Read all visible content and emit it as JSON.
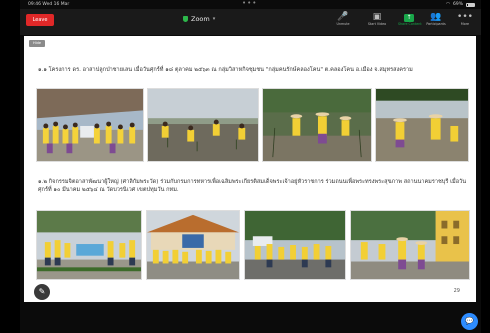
{
  "status_bar": {
    "time": "09:46  Wed 16 Mar",
    "dots": "•••",
    "battery": "69%"
  },
  "toolbar": {
    "leave_label": "Leave",
    "meeting_title": "Zoom",
    "items": [
      {
        "icon": "mic-muted-icon",
        "glyph": "🎤",
        "label": "Unmute"
      },
      {
        "icon": "video-off-icon",
        "glyph": "▣",
        "label": "Start Video"
      },
      {
        "icon": "share-content-icon",
        "glyph": "↑",
        "label": "Share Content"
      },
      {
        "icon": "participants-icon",
        "glyph": "👥",
        "label": "Participants"
      },
      {
        "icon": "more-icon",
        "glyph": "•••",
        "label": "More"
      }
    ]
  },
  "slide": {
    "view_tag": "Hide",
    "caption_1": "๑.๑ โครงการ ดร. อาสาปลูกป่าชายเลน เมื่อวันศุกร์ที่ ๑๘ ตุลาคม ๒๕๖๓ ณ กลุ่มวิสาหกิจชุมชน \"กลุ่มคนรักษ์คลองโคน\" ต.คลองโคน อ.เมือง จ.สมุทรสงคราม",
    "caption_2": "๑.๒ กิจกรรมจิตอาสาพัฒนาผู้ใหญ่ (ศาลิกัมพระวัด) ร่วมกับกรมการทหารเพื่อเฉลิมพระเกียรติสมเด็จพระเจ้าอยู่หัวราชการ ร่วมถนนเพื่อพระทรงพระสุขภาพ สถานนาคมราชบุรี เมื่อวันศุกร์ที่ ๑๐ มีนาคม ๒๕๖๔ ณ วัดบวรนิเวศ เขตปทุมวัน กทม.",
    "page_number": "29",
    "pen_icon": "✎",
    "row1_photos": [
      {
        "name": "photo-group-gathering",
        "scene": "group"
      },
      {
        "name": "photo-mangrove-planting-1",
        "scene": "mud"
      },
      {
        "name": "photo-mangrove-planting-2",
        "scene": "mud2"
      },
      {
        "name": "photo-mangrove-planting-3",
        "scene": "mud3"
      }
    ],
    "row2_photos": [
      {
        "name": "photo-volunteers-banner",
        "scene": "street"
      },
      {
        "name": "photo-volunteers-temple",
        "scene": "temple"
      },
      {
        "name": "photo-volunteers-road",
        "scene": "road"
      },
      {
        "name": "photo-volunteers-building",
        "scene": "building"
      }
    ]
  },
  "bottom": {
    "label": "",
    "chat_icon": "💬"
  },
  "colors": {
    "leave": "#e02828",
    "share_green": "#19a74a",
    "toolbar": "#1a1a1a",
    "accent_blue": "#2d8cff"
  }
}
